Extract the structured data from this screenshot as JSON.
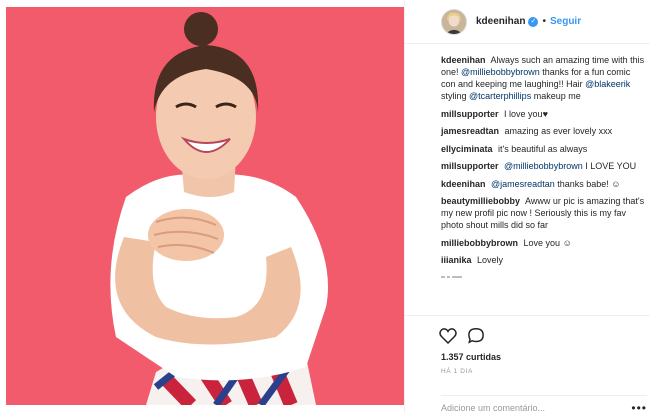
{
  "header": {
    "username": "kdeenihan",
    "verified_symbol": "✓",
    "separator": "•",
    "follow_label": "Seguir"
  },
  "caption": {
    "user": "kdeenihan",
    "text_1": "Always such an amazing time with this one!",
    "mention_1": "@milliebobbybrown",
    "text_2": "thanks for a fun comic con and keeping me laughing!! Hair",
    "mention_2": "@blakeerik",
    "text_3": "styling",
    "mention_3": "@tcarterphillips",
    "text_4": "makeup me"
  },
  "comments": [
    {
      "user": "millsupporter",
      "text": "I love you",
      "emoji": "♥"
    },
    {
      "user": "jamesreadtan",
      "text": "amazing as ever lovely xxx"
    },
    {
      "user": "ellyciminata",
      "text": "it's beautiful as always"
    },
    {
      "user": "millsupporter",
      "mention": "@milliebobbybrown",
      "text": "I LOVE YOU"
    },
    {
      "user": "kdeenihan",
      "mention": "@jamesreadtan",
      "text": "thanks babe!",
      "emoji": "☺"
    },
    {
      "user": "beautymilliebobby",
      "text": "Awww ur pic is amazing that's my new profil pic now ! Seriously this is my fav photo shout mills did so far"
    },
    {
      "user": "milliebobbybrown",
      "text": "Love you",
      "emoji": "☺"
    },
    {
      "user": "iiianika",
      "text": "Lovely"
    }
  ],
  "actions": {
    "like_icon": "heart-icon",
    "comment_icon": "comment-bubble-icon",
    "likes": "1.357 curtidas",
    "date": "HÁ 1 DIA",
    "comment_placeholder": "Adicione um comentário...",
    "more_label": "•••"
  },
  "colors": {
    "photo_background": "#f25b6b",
    "link": "#3897f0",
    "mention": "#003569"
  }
}
